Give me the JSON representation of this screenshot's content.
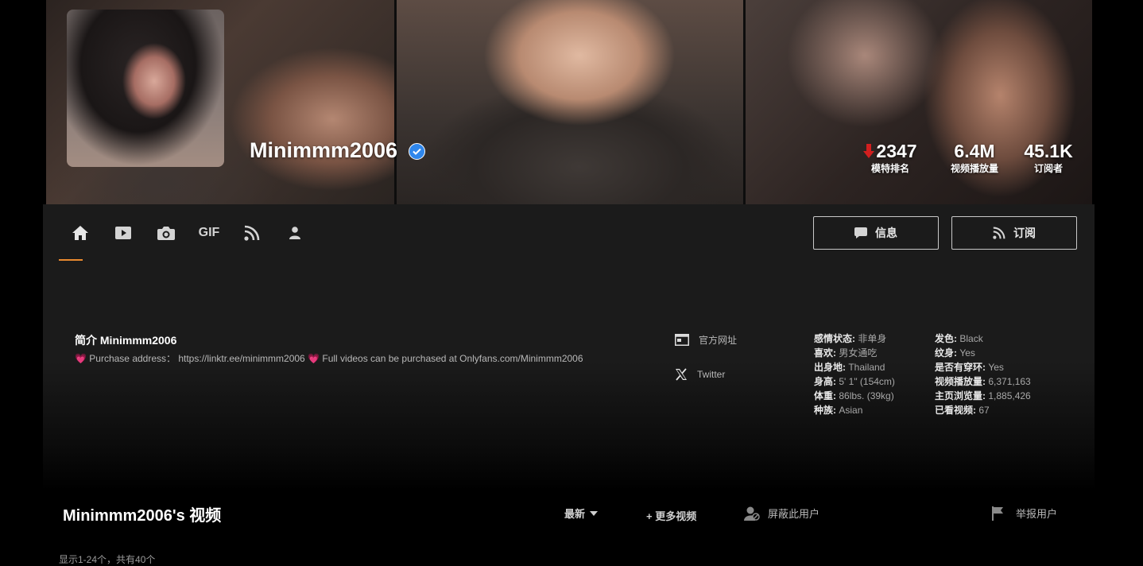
{
  "profile": {
    "name": "Minimmm2006",
    "stats": [
      {
        "value": "2347",
        "label": "模特排名",
        "trend": "down"
      },
      {
        "value": "6.4M",
        "label": "视频播放量"
      },
      {
        "value": "45.1K",
        "label": "订阅者"
      }
    ]
  },
  "nav": {
    "tabs": [
      {
        "icon": "home-icon",
        "active": true
      },
      {
        "icon": "video-icon"
      },
      {
        "icon": "camera-icon"
      },
      {
        "label": "GIF"
      },
      {
        "icon": "rss-icon"
      },
      {
        "icon": "user-icon"
      }
    ],
    "message_label": "信息",
    "subscribe_label": "订阅"
  },
  "bio": {
    "title": "简介 Minimmm2006",
    "text_prefix": " Purchase address： https://linktr.ee/minimmm2006 ",
    "text_suffix": " Full videos can be purchased at Onlyfans.com/Minimmm2006",
    "heart": "💗"
  },
  "links": {
    "official": "官方网址",
    "twitter": "Twitter"
  },
  "info_left": [
    {
      "k": "感情状态:",
      "v": "非单身"
    },
    {
      "k": "喜欢:",
      "v": "男女通吃"
    },
    {
      "k": "出身地:",
      "v": "Thailand"
    },
    {
      "k": "身高:",
      "v": "5' 1\" (154cm)"
    },
    {
      "k": "体重:",
      "v": "86lbs. (39kg)"
    },
    {
      "k": "种族:",
      "v": "Asian"
    }
  ],
  "info_right": [
    {
      "k": "发色:",
      "v": "Black"
    },
    {
      "k": "纹身:",
      "v": "Yes"
    },
    {
      "k": "是否有穿环:",
      "v": "Yes"
    },
    {
      "k": "视频播放量:",
      "v": "6,371,163"
    },
    {
      "k": "主页浏览量:",
      "v": "1,885,426"
    },
    {
      "k": "已看视频:",
      "v": "67"
    }
  ],
  "videos": {
    "title": "Minimmm2006's 视频",
    "sort_label": "最新",
    "more_label": "+ 更多视频",
    "block_label": "屏蔽此用户",
    "report_label": "举报用户",
    "count_text": "显示1-24个，共有40个"
  },
  "colors": {
    "accent": "#e98a2f",
    "verified": "#2f87ec",
    "rank_down": "#d21f1f",
    "heart": "#e23a64"
  }
}
